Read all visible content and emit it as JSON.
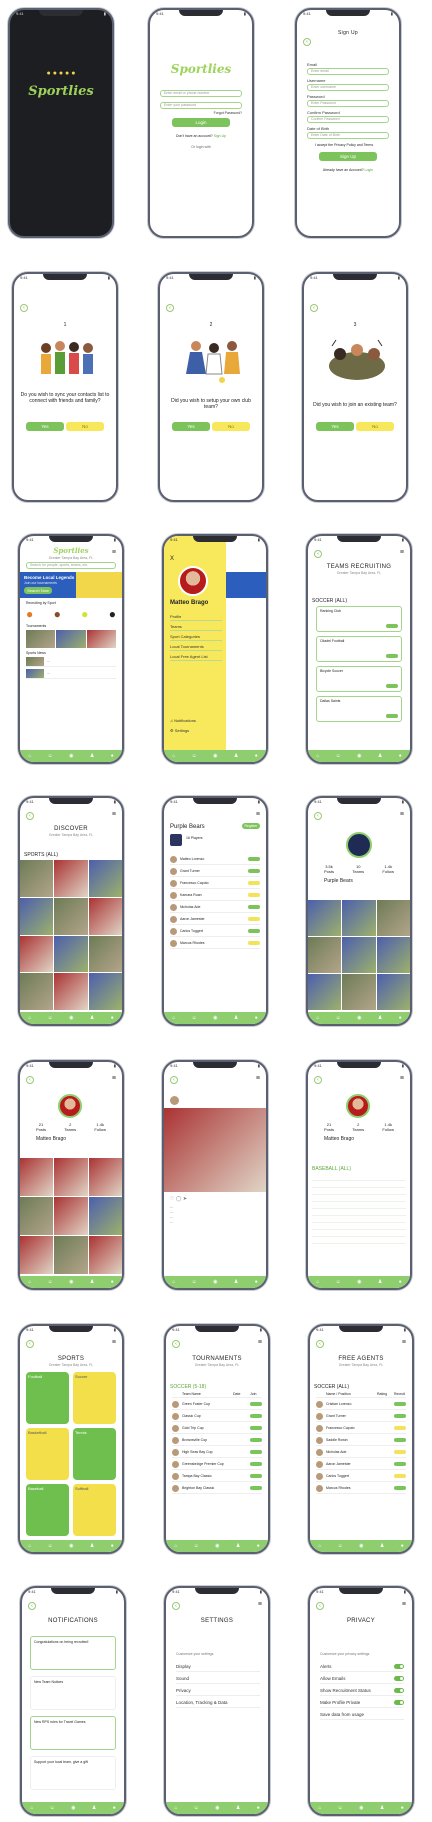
{
  "status": {
    "time": "9:41"
  },
  "brand": {
    "name": "Sportlies",
    "accent": "#7cc35b",
    "yellow": "#f7e75a"
  },
  "login": {
    "email_placeholder": "Enter email or phone number",
    "password_placeholder": "Enter your password",
    "forgot": "Forgot Password?",
    "login_btn": "Login",
    "no_account": "Don't have an account?",
    "signup_link": "Sign Up",
    "or": "Or login with"
  },
  "signup": {
    "title": "Sign Up",
    "fields": [
      {
        "label": "Email",
        "placeholder": "Enter email"
      },
      {
        "label": "Username",
        "placeholder": "Enter username"
      },
      {
        "label": "Password",
        "placeholder": "Enter Password"
      },
      {
        "label": "Confirm Password",
        "placeholder": "Confirm Password"
      },
      {
        "label": "Date of Birth",
        "placeholder": "Enter Date of Birth"
      }
    ],
    "agree": "I accept the Privacy Policy and Terms",
    "button": "Sign Up",
    "have_account": "Already have an Account?",
    "login_link": "Login"
  },
  "onboarding": [
    {
      "step": "1",
      "question": "Do you wish to sync your contacts list to connect with friends and family?",
      "yes": "Yes",
      "no": "No"
    },
    {
      "step": "2",
      "question": "Did you wish to setup your own club team?",
      "yes": "Yes",
      "no": "No"
    },
    {
      "step": "3",
      "question": "Did you wish to join an existing team?",
      "yes": "Yes",
      "no": "No"
    }
  ],
  "home": {
    "location": "Greater Tampa Bay Area, FL",
    "search_placeholder": "Search for people, sports, teams, etc.",
    "banner_title": "Become Local Legends",
    "banner_sub": "Join our tournaments",
    "banner_btn": "Search Now",
    "section1": "Recruiting by Sport",
    "section2": "Tournaments",
    "section3": "Sports News"
  },
  "menu": {
    "close": "X",
    "name": "Matteo Brago",
    "items": [
      "Profile",
      "Teams",
      "Sport Categories",
      "Local Tournaments",
      "Local Free Agent List"
    ],
    "notifications": "Notifications",
    "settings": "Settings"
  },
  "teams_recruiting": {
    "title": "TEAMS RECRUITING",
    "location": "Greater Tampa Bay Area, FL",
    "filter": "SOCCER (ALL)",
    "cards": [
      "Ranking Club",
      "Citadel Football",
      "Bicycle Soccer",
      "Dallas Saints"
    ]
  },
  "discover": {
    "title": "DISCOVER",
    "location": "Greater Tampa Bay Area, FL",
    "filter": "SPORTS (ALL)"
  },
  "team": {
    "name": "Purple Bears",
    "register": "Register",
    "members_label": "16 Players",
    "players": [
      "Matteo Lorenzo",
      "Grant Turner",
      "Francesco Caputo",
      "Kamara Ruan",
      "Nicholas Ade",
      "Aaron Jamester",
      "Carlos Tuggert",
      "Marcus Rhodes"
    ]
  },
  "team_profile": {
    "name": "Purple Bears",
    "stats": [
      {
        "n": "3.5k",
        "l": "Posts"
      },
      {
        "n": "10",
        "l": "Teams"
      },
      {
        "n": "1.4k",
        "l": "Follow"
      }
    ]
  },
  "player_profile": {
    "name": "Matteo Brago",
    "stats": [
      {
        "n": "21",
        "l": "Posts"
      },
      {
        "n": "2",
        "l": "Teams"
      },
      {
        "n": "1.4k",
        "l": "Follow"
      }
    ],
    "filter": "BASEBALL (ALL)"
  },
  "sports": {
    "title": "SPORTS",
    "location": "Greater Tampa Bay Area, FL",
    "items": [
      "Football",
      "Soccer",
      "Basketball",
      "Tennis",
      "Baseball",
      "Softball"
    ]
  },
  "tournaments": {
    "title": "TOURNAMENTS",
    "location": "Greater Tampa Bay Area, FL",
    "filter": "SOCCER (5-18)",
    "columns": [
      "Team Name",
      "Date",
      "Join"
    ],
    "rows": [
      "Green Foster Cup",
      "Classic Cup",
      "Gold Trip Cup",
      "Brownsville Cup",
      "High Seas Bay Cup",
      "Greensbridge Premier Cup",
      "Tampa Bay Classic",
      "Brighton Bay Classic"
    ]
  },
  "free_agents": {
    "title": "FREE AGENTS",
    "location": "Greater Tampa Bay Area, FL",
    "filter": "SOCCER (ALL)",
    "columns": [
      "Name / Position",
      "Rating",
      "Recruit"
    ],
    "rows": [
      "Cristian Lorenzo",
      "Grant Turner",
      "Francesco Caputo",
      "Saddle Rowin",
      "Nicholas Ade",
      "Aaron Jamester",
      "Carlos Tuggert",
      "Marcus Rhodes"
    ]
  },
  "notifications": {
    "title": "NOTIFICATIONS",
    "items": [
      "Congratulations on being recruited!",
      "New Team Notices",
      "New RPS rules for Travel Games",
      "Support your local team, give a gift"
    ]
  },
  "settings": {
    "title": "SETTINGS",
    "intro": "Customize your settings",
    "items": [
      "Display",
      "Sound",
      "Privacy",
      "Location, Tracking & Data"
    ]
  },
  "privacy": {
    "title": "PRIVACY",
    "intro": "Customize your privacy settings",
    "items": [
      "Alerts",
      "Allow Emails",
      "Show Recruitment Status",
      "Make Profile Private",
      "Save data from usage"
    ]
  }
}
